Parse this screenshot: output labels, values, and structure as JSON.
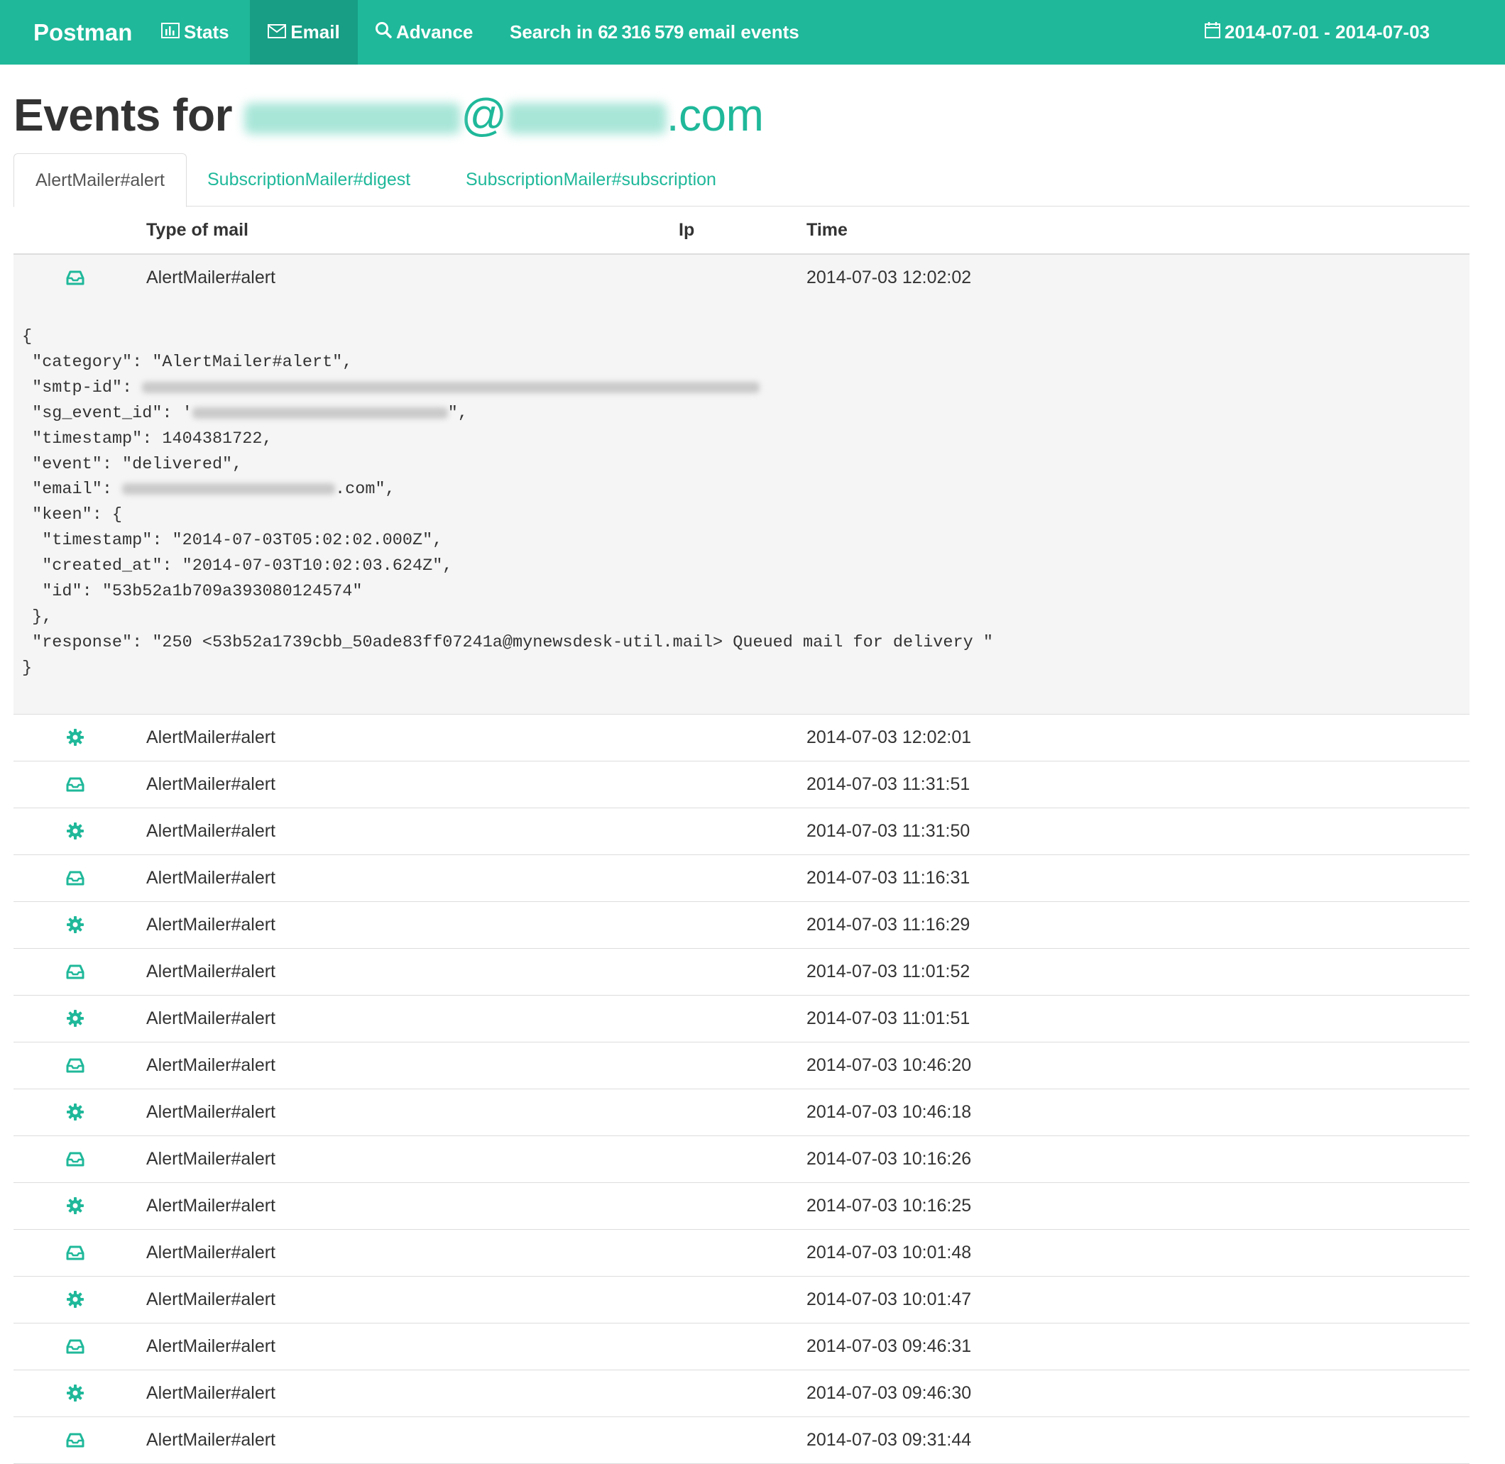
{
  "navbar": {
    "brand": "Postman",
    "stats_label": "Stats",
    "email_label": "Email",
    "advance_label": "Advance",
    "search_prefix": "Search in",
    "search_count": "62 316 579",
    "search_suffix": "email events",
    "date_range": "2014-07-01 - 2014-07-03",
    "accent_color": "#1fb89a"
  },
  "page": {
    "title_prefix": "Events for",
    "title_email_at": "@",
    "title_email_domain": ".com"
  },
  "tabs": [
    {
      "label": "AlertMailer#alert",
      "active": true
    },
    {
      "label": "SubscriptionMailer#digest",
      "active": false
    },
    {
      "label": "SubscriptionMailer#subscription",
      "active": false
    }
  ],
  "table": {
    "headers": {
      "type": "Type of mail",
      "ip": "Ip",
      "time": "Time"
    },
    "expanded_row": {
      "icon": "inbox-icon",
      "type": "AlertMailer#alert",
      "time": "2014-07-03 12:02:02",
      "json": {
        "open_brace": "{",
        "l_category": " \"category\": \"AlertMailer#alert\",",
        "l_smtp": " \"smtp-id\": ",
        "l_sg": " \"sg_event_id\": '",
        "l_sg_end": "\",",
        "l_timestamp": " \"timestamp\": 1404381722,",
        "l_event": " \"event\": \"delivered\",",
        "l_email": " \"email\": ",
        "l_email_end": ".com\",",
        "l_keen": " \"keen\": {",
        "l_keen_ts": "  \"timestamp\": \"2014-07-03T05:02:02.000Z\",",
        "l_keen_created": "  \"created_at\": \"2014-07-03T10:02:03.624Z\",",
        "l_keen_id": "  \"id\": \"53b52a1b709a393080124574\"",
        "l_keen_close": " },",
        "l_response": " \"response\": \"250 <53b52a1739cbb_50ade83ff07241a@mynewsdesk-util.mail> Queued mail for delivery \"",
        "close_brace": "}"
      }
    },
    "rows": [
      {
        "icon": "gear-icon",
        "type": "AlertMailer#alert",
        "time": "2014-07-03 12:02:01"
      },
      {
        "icon": "inbox-icon",
        "type": "AlertMailer#alert",
        "time": "2014-07-03 11:31:51"
      },
      {
        "icon": "gear-icon",
        "type": "AlertMailer#alert",
        "time": "2014-07-03 11:31:50"
      },
      {
        "icon": "inbox-icon",
        "type": "AlertMailer#alert",
        "time": "2014-07-03 11:16:31"
      },
      {
        "icon": "gear-icon",
        "type": "AlertMailer#alert",
        "time": "2014-07-03 11:16:29"
      },
      {
        "icon": "inbox-icon",
        "type": "AlertMailer#alert",
        "time": "2014-07-03 11:01:52"
      },
      {
        "icon": "gear-icon",
        "type": "AlertMailer#alert",
        "time": "2014-07-03 11:01:51"
      },
      {
        "icon": "inbox-icon",
        "type": "AlertMailer#alert",
        "time": "2014-07-03 10:46:20"
      },
      {
        "icon": "gear-icon",
        "type": "AlertMailer#alert",
        "time": "2014-07-03 10:46:18"
      },
      {
        "icon": "inbox-icon",
        "type": "AlertMailer#alert",
        "time": "2014-07-03 10:16:26"
      },
      {
        "icon": "gear-icon",
        "type": "AlertMailer#alert",
        "time": "2014-07-03 10:16:25"
      },
      {
        "icon": "inbox-icon",
        "type": "AlertMailer#alert",
        "time": "2014-07-03 10:01:48"
      },
      {
        "icon": "gear-icon",
        "type": "AlertMailer#alert",
        "time": "2014-07-03 10:01:47"
      },
      {
        "icon": "inbox-icon",
        "type": "AlertMailer#alert",
        "time": "2014-07-03 09:46:31"
      },
      {
        "icon": "gear-icon",
        "type": "AlertMailer#alert",
        "time": "2014-07-03 09:46:30"
      },
      {
        "icon": "inbox-icon",
        "type": "AlertMailer#alert",
        "time": "2014-07-03 09:31:44"
      }
    ]
  }
}
